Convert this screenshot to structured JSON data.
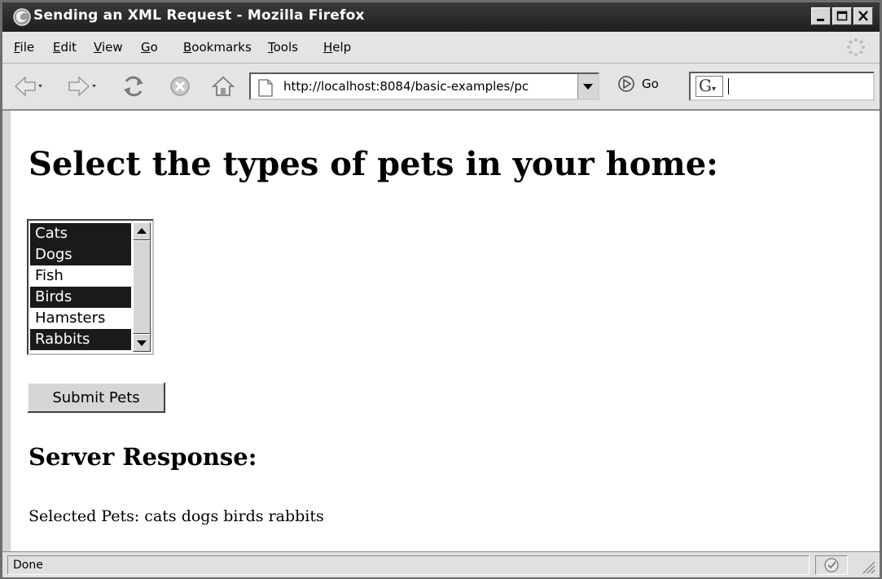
{
  "window": {
    "title": "Sending an XML Request - Mozilla Firefox"
  },
  "menubar": {
    "items": [
      {
        "label": "File",
        "accel": "F",
        "rest": "ile"
      },
      {
        "label": "Edit",
        "accel": "E",
        "rest": "dit"
      },
      {
        "label": "View",
        "accel": "V",
        "rest": "iew"
      },
      {
        "label": "Go",
        "accel": "G",
        "rest": "o"
      },
      {
        "label": "Bookmarks",
        "accel": "B",
        "rest": "ookmarks"
      },
      {
        "label": "Tools",
        "accel": "T",
        "rest": "ools"
      },
      {
        "label": "Help",
        "accel": "H",
        "rest": "elp"
      }
    ]
  },
  "navbar": {
    "url": "http://localhost:8084/basic-examples/pc",
    "go_label": "Go",
    "search_value": ""
  },
  "page": {
    "heading": "Select the types of pets in your home:",
    "pets": [
      {
        "label": "Cats",
        "selected": true
      },
      {
        "label": "Dogs",
        "selected": true
      },
      {
        "label": "Fish",
        "selected": false
      },
      {
        "label": "Birds",
        "selected": true
      },
      {
        "label": "Hamsters",
        "selected": false
      },
      {
        "label": "Rabbits",
        "selected": true
      }
    ],
    "submit_label": "Submit Pets",
    "response_heading": "Server Response:",
    "response_text": "Selected Pets: cats dogs birds rabbits"
  },
  "statusbar": {
    "text": "Done"
  },
  "colors": {
    "titlebar": "#2a2a2a",
    "chrome": "#e4e4e4",
    "selection": "#1a1a1a"
  }
}
